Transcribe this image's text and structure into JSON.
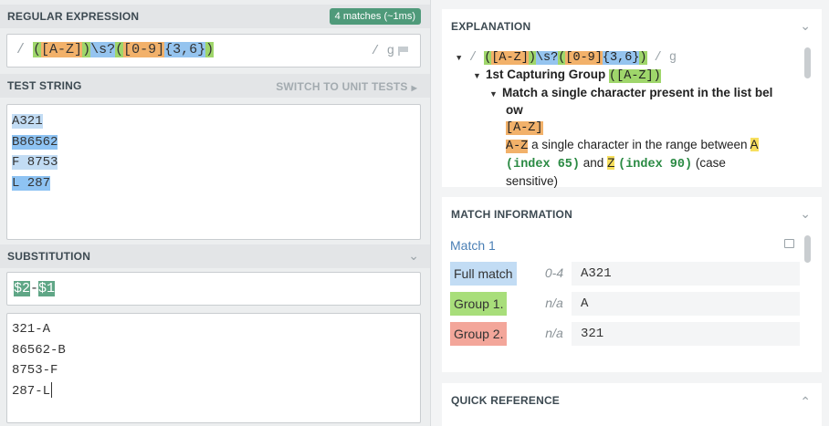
{
  "regex_section": {
    "title": "REGULAR EXPRESSION",
    "match_badge": "4 matches (~1ms)",
    "delimiter_open": "/",
    "tokens": [
      {
        "text": "(",
        "style": "green"
      },
      {
        "text": "[A-Z]",
        "style": "orange"
      },
      {
        "text": ")",
        "style": "green"
      },
      {
        "text": "\\s?",
        "style": "blue"
      },
      {
        "text": "(",
        "style": "green"
      },
      {
        "text": "[0-9]",
        "style": "orange"
      },
      {
        "text": "{3,6}",
        "style": "blue"
      },
      {
        "text": ")",
        "style": "green"
      }
    ],
    "flags": "/ g",
    "flag_icon": "flag-icon"
  },
  "test_section": {
    "title": "TEST STRING",
    "switch_label": "SWITCH TO UNIT TESTS",
    "lines": [
      "A321",
      "B86562",
      "F 8753",
      "L 287"
    ]
  },
  "substitution_section": {
    "title": "SUBSTITUTION",
    "tokens": [
      {
        "text": "$2",
        "style": "green"
      },
      {
        "text": "-",
        "style": "plain"
      },
      {
        "text": "$1",
        "style": "green"
      }
    ],
    "output_lines": [
      "321-A",
      "86562-B",
      "8753-F",
      "287-L"
    ]
  },
  "explanation": {
    "title": "EXPLANATION",
    "pattern_line_prefix": "/",
    "pattern_line_suffix": "/ g",
    "group1_label": "1st Capturing Group",
    "group1_token": "([A-Z])",
    "match_single_line1": "Match a single character present in the list bel",
    "match_single_line2": "ow",
    "class_token": "[A-Z]",
    "range_token": "A-Z",
    "range_desc": "a single character in the range between",
    "char_a": "A",
    "index_a": "(index 65)",
    "and_word": "and",
    "char_z": "Z",
    "index_z": "(index 90)",
    "case_open": "(case",
    "case_close": "sensitive)"
  },
  "match_info": {
    "title": "MATCH INFORMATION",
    "match_name": "Match 1",
    "rows": [
      {
        "label": "Full match",
        "range": "0-4",
        "value": "A321"
      },
      {
        "label": "Group 1.",
        "range": "n/a",
        "value": "A"
      },
      {
        "label": "Group 2.",
        "range": "n/a",
        "value": "321"
      }
    ]
  },
  "quick_reference": {
    "title": "QUICK REFERENCE"
  },
  "colors": {
    "group_green": "#9fd66b",
    "class_orange": "#f2b16a",
    "quant_blue": "#95c4ef",
    "badge_green": "#4f9a7a"
  }
}
